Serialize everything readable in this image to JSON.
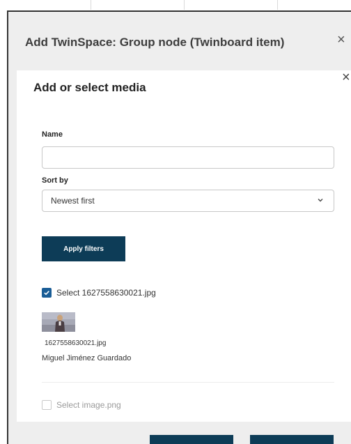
{
  "outer_dialog": {
    "title": "Add TwinSpace: Group node (Twinboard item)",
    "close_symbol": "×"
  },
  "media_dialog": {
    "title": "Add or select media",
    "close_symbol": "×",
    "filters": {
      "name_label": "Name",
      "name_value": "",
      "sort_label": "Sort by",
      "sort_value": "Newest first",
      "apply_label": "Apply filters"
    },
    "items": [
      {
        "select_label": "Select 1627558630021.jpg",
        "checked": true,
        "file_name": "1627558630021.jpg",
        "owner": "Miguel Jiménez Guardado"
      },
      {
        "select_label": "Select image.png",
        "checked": false
      }
    ]
  },
  "colors": {
    "primary_button": "#0d3c57",
    "checkbox_checked": "#1a5d96"
  }
}
